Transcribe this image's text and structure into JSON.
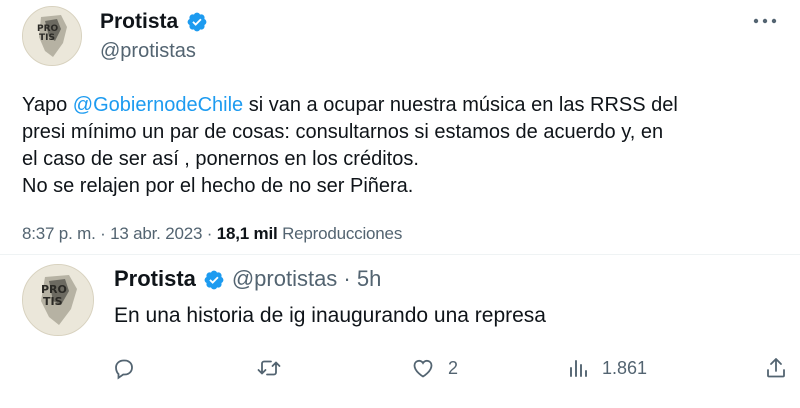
{
  "main_tweet": {
    "display_name": "Protista",
    "handle": "@protistas",
    "text_before": "Yapo ",
    "mention": "@GobiernodeChile",
    "text_line1_rest": " si van a ocupar nuestra música  en las RRSS del",
    "text_line2": "presi mínimo un par de cosas: consultarnos si estamos de acuerdo y, en",
    "text_line3": "el caso de ser así , ponernos en los créditos.",
    "text_line4": "No se relajen por el hecho de no ser Piñera.",
    "timestamp": "8:37 p. m. · 13 abr. 2023 · ",
    "views_count": "18,1 mil",
    "views_label": "Reproducciones"
  },
  "reply_tweet": {
    "display_name": "Protista",
    "handle_time": "@protistas · 5h",
    "text": "En una historia de ig inaugurando una represa",
    "reply_count": "",
    "retweet_count": "",
    "like_count": "2",
    "views_count": "1.861"
  },
  "colors": {
    "accent": "#1d9bf0",
    "secondary_text": "#536471",
    "primary_text": "#0f1419"
  }
}
